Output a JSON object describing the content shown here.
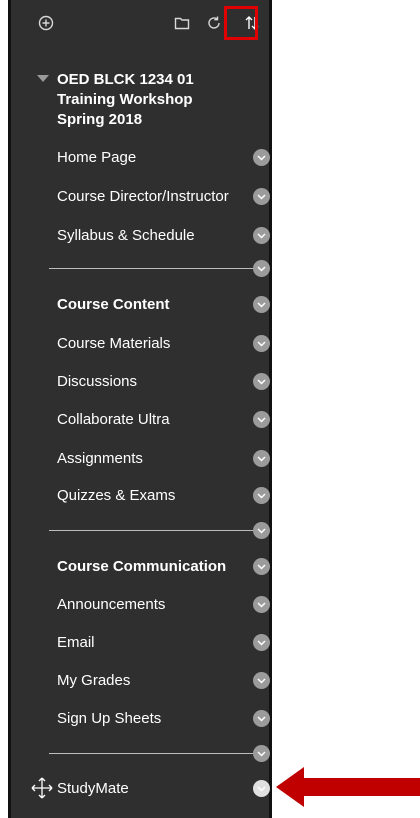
{
  "course": {
    "title_line1": "OED BLCK 1234 01",
    "title_line2": "Training Workshop",
    "title_line3": "Spring 2018"
  },
  "toolbar": {
    "icons": [
      "add-icon",
      "folder-icon",
      "refresh-icon",
      "reorder-icon"
    ]
  },
  "menu": {
    "group1": [
      "Home Page",
      "Course Director/Instructor",
      "Syllabus & Schedule"
    ],
    "heading_content": "Course Content",
    "group2": [
      "Course Materials",
      "Discussions",
      "Collaborate Ultra",
      "Assignments",
      "Quizzes & Exams"
    ],
    "heading_communication": "Course Communication",
    "group3": [
      "Announcements",
      "Email",
      "My Grades",
      "Sign Up Sheets"
    ],
    "dragged_item": "StudyMate"
  },
  "colors": {
    "panel_bg": "#2f2f2f",
    "highlight": "#e00000",
    "arrow": "#c00000",
    "chevron": "#9b9b9b"
  }
}
